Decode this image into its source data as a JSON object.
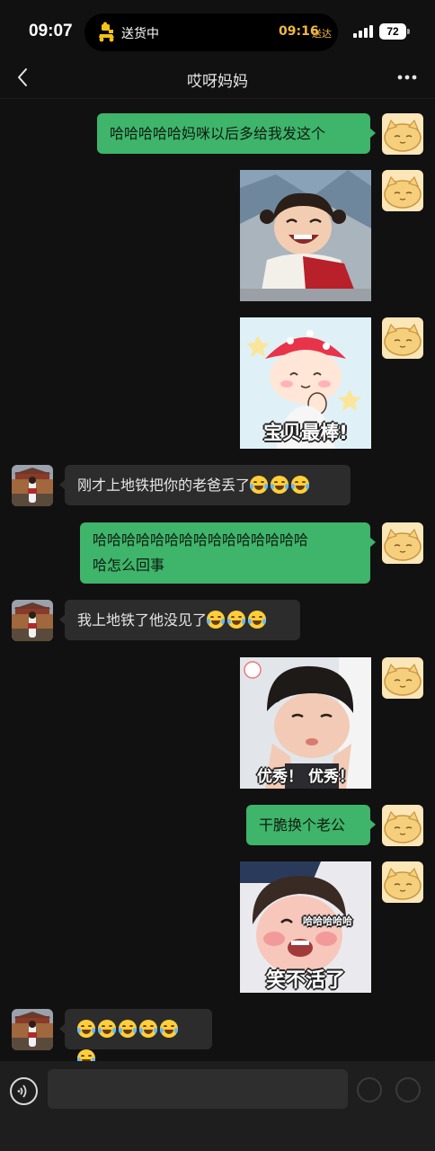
{
  "status_bar": {
    "time": "09:07",
    "activity": {
      "label": "送货中",
      "eta": "09:16",
      "eta_suffix": "送达",
      "icon": "delivery-scooter-icon"
    },
    "battery": "72",
    "signal_icon": "cellular-signal-icon"
  },
  "nav": {
    "title": "哎呀妈妈",
    "back_icon": "chevron-left-icon",
    "more_icon": "more-dots-icon"
  },
  "messages": [
    {
      "from": "me",
      "type": "text",
      "text": "哈哈哈哈哈妈咪以后多给我发这个"
    },
    {
      "from": "me",
      "type": "sticker",
      "sticker": "laughing-girl-in-costume"
    },
    {
      "from": "me",
      "type": "sticker",
      "sticker": "cartoon-girl-mushroom-hat",
      "caption": "宝贝最棒!"
    },
    {
      "from": "mom",
      "type": "text",
      "text": "刚才上地铁把你的老爸丢了",
      "emoji_count": 3
    },
    {
      "from": "me",
      "type": "text",
      "text": "哈哈哈哈哈哈哈哈哈哈哈哈哈哈哈哈哈哈哈怎么回事",
      "lines": [
        "哈哈哈哈哈哈哈哈哈哈哈哈哈哈哈",
        "哈怎么回事"
      ]
    },
    {
      "from": "mom",
      "type": "text",
      "text": "我上地铁了他没见了",
      "emoji_count": 3
    },
    {
      "from": "me",
      "type": "sticker",
      "sticker": "girl-hands-on-cheeks",
      "caption": "优秀！ 优秀！"
    },
    {
      "from": "me",
      "type": "text",
      "text": "干脆换个老公"
    },
    {
      "from": "me",
      "type": "sticker",
      "sticker": "girl-laughing-hard",
      "caption": "笑不活了",
      "top_text": "哈哈哈哈哈"
    },
    {
      "from": "mom",
      "type": "emoji_only",
      "emoji_count": 6,
      "emoji_name": "tears-of-joy-emoji"
    }
  ],
  "input_bar": {
    "voice_icon": "voice-icon",
    "placeholder": "",
    "emoji_icon": "emoji-icon",
    "plus_icon": "plus-icon"
  },
  "colors": {
    "background": "#111111",
    "outgoing_bubble": "#3eb56a",
    "incoming_bubble": "#2c2c2c",
    "eta_accent": "#f0b843"
  }
}
